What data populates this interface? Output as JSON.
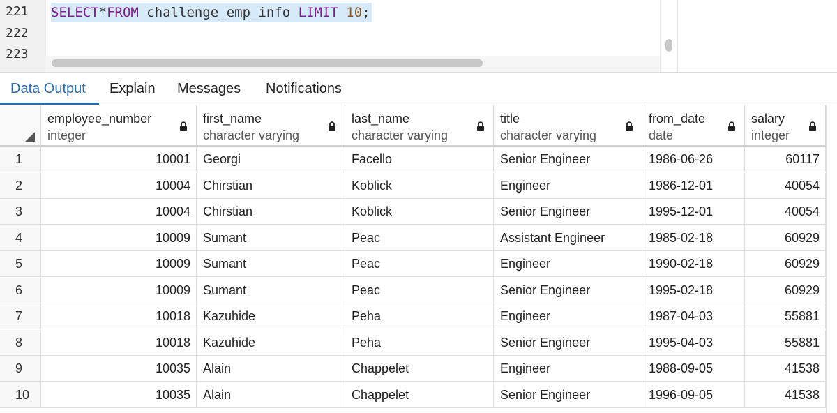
{
  "editor": {
    "lines": [
      {
        "number": "221",
        "tokens": [
          {
            "text": "SELECT",
            "kind": "keyword"
          },
          {
            "text": "*",
            "kind": "plain"
          },
          {
            "text": "FROM",
            "kind": "keyword"
          },
          {
            "text": " challenge_emp_info ",
            "kind": "plain"
          },
          {
            "text": "LIMIT",
            "kind": "keyword"
          },
          {
            "text": " ",
            "kind": "plain"
          },
          {
            "text": "10",
            "kind": "number"
          },
          {
            "text": ";",
            "kind": "plain"
          }
        ]
      },
      {
        "number": "222",
        "tokens": []
      },
      {
        "number": "223",
        "tokens": []
      }
    ]
  },
  "tabs": [
    {
      "label": "Data Output",
      "active": true
    },
    {
      "label": "Explain",
      "active": false
    },
    {
      "label": "Messages",
      "active": false
    },
    {
      "label": "Notifications",
      "active": false
    }
  ],
  "grid": {
    "columns": [
      {
        "name": "employee_number",
        "type": "integer",
        "locked": true
      },
      {
        "name": "first_name",
        "type": "character varying",
        "locked": true
      },
      {
        "name": "last_name",
        "type": "character varying",
        "locked": true
      },
      {
        "name": "title",
        "type": "character varying",
        "locked": true
      },
      {
        "name": "from_date",
        "type": "date",
        "locked": true
      },
      {
        "name": "salary",
        "type": "integer",
        "locked": true
      }
    ],
    "rows": [
      [
        "1",
        "10001",
        "Georgi",
        "Facello",
        "Senior Engineer",
        "1986-06-26",
        "60117"
      ],
      [
        "2",
        "10004",
        "Chirstian",
        "Koblick",
        "Engineer",
        "1986-12-01",
        "40054"
      ],
      [
        "3",
        "10004",
        "Chirstian",
        "Koblick",
        "Senior Engineer",
        "1995-12-01",
        "40054"
      ],
      [
        "4",
        "10009",
        "Sumant",
        "Peac",
        "Assistant Engineer",
        "1985-02-18",
        "60929"
      ],
      [
        "5",
        "10009",
        "Sumant",
        "Peac",
        "Engineer",
        "1990-02-18",
        "60929"
      ],
      [
        "6",
        "10009",
        "Sumant",
        "Peac",
        "Senior Engineer",
        "1995-02-18",
        "60929"
      ],
      [
        "7",
        "10018",
        "Kazuhide",
        "Peha",
        "Engineer",
        "1987-04-03",
        "55881"
      ],
      [
        "8",
        "10018",
        "Kazuhide",
        "Peha",
        "Senior Engineer",
        "1995-04-03",
        "55881"
      ],
      [
        "9",
        "10035",
        "Alain",
        "Chappelet",
        "Engineer",
        "1988-09-05",
        "41538"
      ],
      [
        "10",
        "10035",
        "Alain",
        "Chappelet",
        "Senior Engineer",
        "1996-09-05",
        "41538"
      ]
    ]
  },
  "colors": {
    "accent": "#2a6bb0",
    "keyword": "#7a1e8a",
    "number": "#8a5a2b",
    "selection": "#d7eafa"
  }
}
